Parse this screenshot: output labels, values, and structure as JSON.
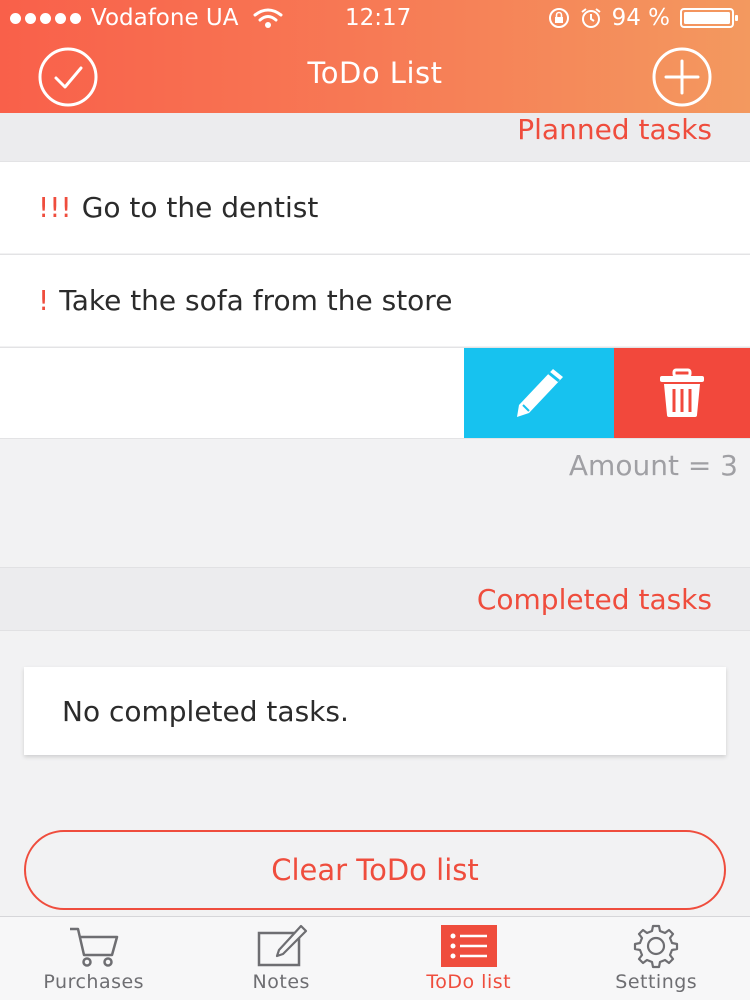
{
  "status_bar": {
    "carrier": "Vodafone UA",
    "time": "12:17",
    "battery": "94 %"
  },
  "nav": {
    "title": "ToDo List"
  },
  "planned": {
    "header": "Planned tasks",
    "tasks": [
      {
        "priority": "!!!",
        "text": "Go to the dentist"
      },
      {
        "priority": "!",
        "text": "Take the sofa from the store"
      }
    ],
    "amount": "Amount = 3"
  },
  "completed": {
    "header": "Completed tasks",
    "empty_message": "No completed tasks."
  },
  "clear_button": "Clear ToDo list",
  "tabs": [
    {
      "label": "Purchases",
      "icon": "cart-icon"
    },
    {
      "label": "Notes",
      "icon": "notes-icon"
    },
    {
      "label": "ToDo list",
      "icon": "list-icon",
      "active": true
    },
    {
      "label": "Settings",
      "icon": "gear-icon"
    }
  ],
  "colors": {
    "accent": "#ef4d3d",
    "header_start": "#f9604a",
    "header_end": "#f3995f",
    "edit": "#17c2ef",
    "delete": "#f2483c"
  }
}
